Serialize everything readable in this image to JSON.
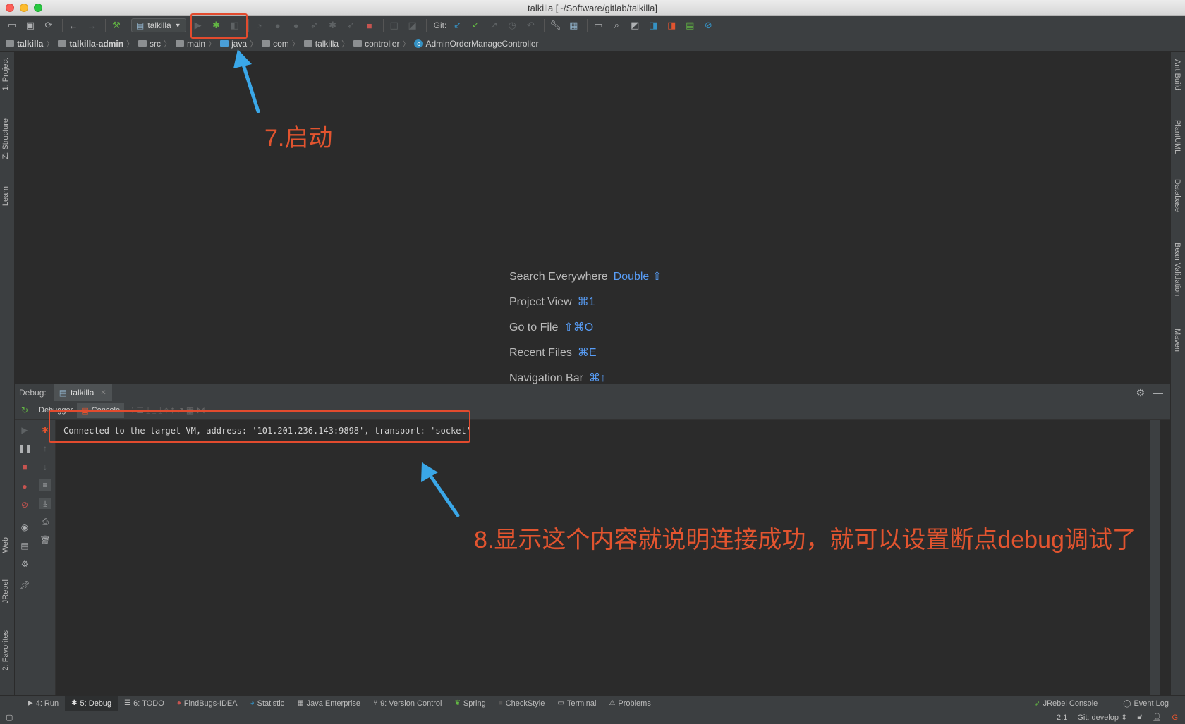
{
  "window": {
    "title": "talkilla [~/Software/gitlab/talkilla]"
  },
  "toolbar": {
    "run_config": "talkilla",
    "git_label": "Git:"
  },
  "breadcrumb": {
    "items": [
      "talkilla",
      "talkilla-admin",
      "src",
      "main",
      "java",
      "com",
      "talkilla",
      "controller",
      "AdminOrderManageController"
    ]
  },
  "left_strip": {
    "tabs": [
      "1: Project",
      "Z: Structure",
      "Learn",
      "Web",
      "JRebel",
      "2: Favorites"
    ]
  },
  "right_strip": {
    "tabs": [
      "Ant Build",
      "PlantUML",
      "Database",
      "Bean Validation",
      "Maven"
    ]
  },
  "editor_hints": [
    {
      "label": "Search Everywhere",
      "key": "Double ⇧"
    },
    {
      "label": "Project View",
      "key": "⌘1"
    },
    {
      "label": "Go to File",
      "key": "⇧⌘O"
    },
    {
      "label": "Recent Files",
      "key": "⌘E"
    },
    {
      "label": "Navigation Bar",
      "key": "⌘↑"
    }
  ],
  "debug": {
    "label": "Debug:",
    "session_tab": "talkilla",
    "subtabs": [
      "Debugger",
      "Console"
    ],
    "console_text": "Connected to the target VM, address: '101.201.236.143:9898', transport: 'socket'"
  },
  "bottom_tools": [
    {
      "label": "4: Run",
      "icon": "run-icon"
    },
    {
      "label": "5: Debug",
      "icon": "bug-icon",
      "active": true
    },
    {
      "label": "6: TODO",
      "icon": "list-icon"
    },
    {
      "label": "FindBugs-IDEA",
      "icon": "findbugs-icon"
    },
    {
      "label": "Statistic",
      "icon": "statistic-icon"
    },
    {
      "label": "Java Enterprise",
      "icon": "enterprise-icon"
    },
    {
      "label": "9: Version Control",
      "icon": "vcs-icon"
    },
    {
      "label": "Spring",
      "icon": "spring-icon"
    },
    {
      "label": "CheckStyle",
      "icon": "checkstyle-icon"
    },
    {
      "label": "Terminal",
      "icon": "terminal-icon"
    },
    {
      "label": "Problems",
      "icon": "warning-icon"
    }
  ],
  "bottom_right": [
    "JRebel Console",
    "Event Log"
  ],
  "status": {
    "position": "2:1",
    "git_branch": "Git: develop ⇕"
  },
  "annotations": {
    "step7": "7.启动",
    "step8": "8.显示这个内容就说明连接成功，就可以设置断点debug调试了"
  },
  "colors": {
    "annotation": "#e24b2e",
    "arrow": "#3aa7e8",
    "shortcut": "#589df6",
    "background": "#2b2b2b"
  }
}
